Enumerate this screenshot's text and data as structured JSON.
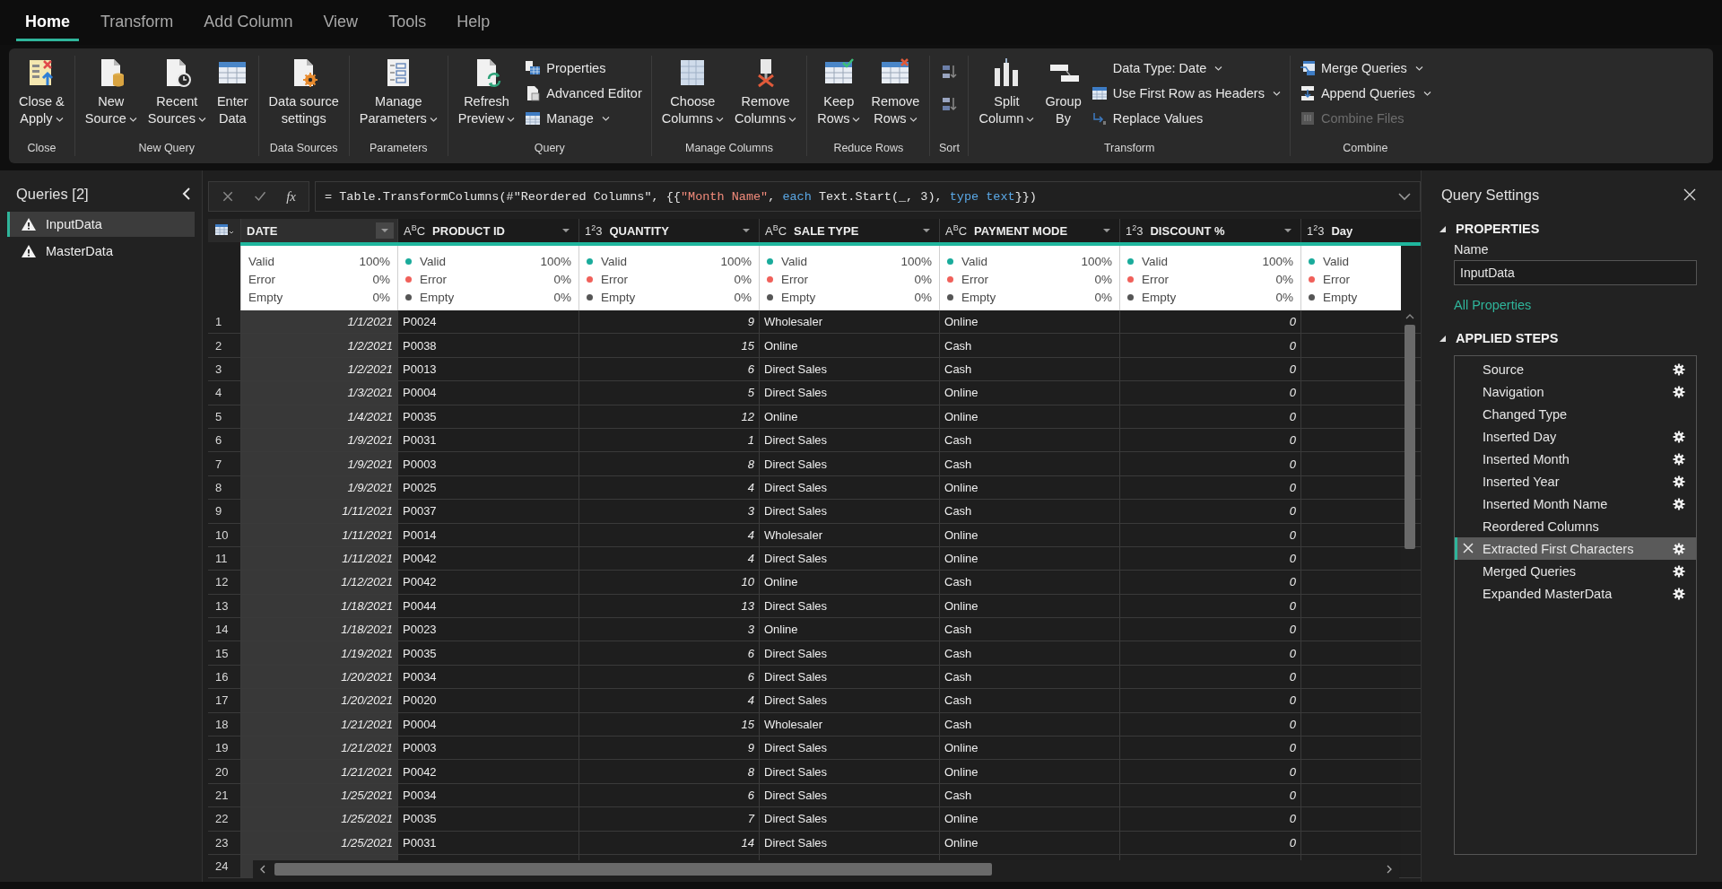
{
  "ribbon_tabs": [
    {
      "label": "Home",
      "selected": true
    },
    {
      "label": "Transform",
      "selected": false
    },
    {
      "label": "Add Column",
      "selected": false
    },
    {
      "label": "View",
      "selected": false
    },
    {
      "label": "Tools",
      "selected": false
    },
    {
      "label": "Help",
      "selected": false
    }
  ],
  "ribbon_groups": [
    {
      "label": "Close",
      "items": [
        {
          "kind": "large",
          "lines": [
            "Close &",
            "Apply"
          ],
          "dropdown": true
        }
      ]
    },
    {
      "label": "New Query",
      "items": [
        {
          "kind": "large",
          "lines": [
            "New",
            "Source"
          ],
          "dropdown": true
        },
        {
          "kind": "large",
          "lines": [
            "Recent",
            "Sources"
          ],
          "dropdown": true
        },
        {
          "kind": "large",
          "lines": [
            "Enter",
            "Data"
          ],
          "dropdown": false
        }
      ]
    },
    {
      "label": "Data Sources",
      "items": [
        {
          "kind": "large",
          "lines": [
            "Data source",
            "settings"
          ],
          "dropdown": false
        }
      ]
    },
    {
      "label": "Parameters",
      "items": [
        {
          "kind": "large",
          "lines": [
            "Manage",
            "Parameters"
          ],
          "dropdown": true
        }
      ]
    },
    {
      "label": "Query",
      "items": [
        {
          "kind": "large",
          "lines": [
            "Refresh",
            "Preview"
          ],
          "dropdown": true
        },
        {
          "kind": "small",
          "label": "Properties",
          "dropdown": false
        },
        {
          "kind": "small",
          "label": "Advanced Editor",
          "dropdown": false
        },
        {
          "kind": "small",
          "label": "Manage",
          "dropdown": true
        }
      ]
    },
    {
      "label": "Manage Columns",
      "items": [
        {
          "kind": "large",
          "lines": [
            "Choose",
            "Columns"
          ],
          "dropdown": true
        },
        {
          "kind": "large",
          "lines": [
            "Remove",
            "Columns"
          ],
          "dropdown": true
        }
      ]
    },
    {
      "label": "Reduce Rows",
      "items": [
        {
          "kind": "large",
          "lines": [
            "Keep",
            "Rows"
          ],
          "dropdown": true
        },
        {
          "kind": "large",
          "lines": [
            "Remove",
            "Rows"
          ],
          "dropdown": true
        }
      ]
    },
    {
      "label": "Sort",
      "items": [
        {
          "kind": "icon"
        },
        {
          "kind": "icon"
        }
      ]
    },
    {
      "label": "Transform",
      "items": [
        {
          "kind": "large",
          "lines": [
            "Split",
            "Column"
          ],
          "dropdown": true
        },
        {
          "kind": "large",
          "lines": [
            "Group",
            "By"
          ],
          "dropdown": false
        },
        {
          "kind": "small",
          "label": "Data Type: Date",
          "dropdown": true
        },
        {
          "kind": "small",
          "label": "Use First Row as Headers",
          "dropdown": true
        },
        {
          "kind": "small",
          "label": "Replace Values",
          "dropdown": false
        }
      ]
    },
    {
      "label": "Combine",
      "items": [
        {
          "kind": "small",
          "label": "Merge Queries",
          "dropdown": true,
          "disabled": false
        },
        {
          "kind": "small",
          "label": "Append Queries",
          "dropdown": true,
          "disabled": false
        },
        {
          "kind": "small",
          "label": "Combine Files",
          "dropdown": false,
          "disabled": true
        }
      ]
    }
  ],
  "queries": {
    "title": "Queries [2]",
    "items": [
      {
        "name": "InputData",
        "warning": true,
        "selected": true
      },
      {
        "name": "MasterData",
        "warning": true,
        "selected": false
      }
    ]
  },
  "formula_bar": {
    "fx": "fx",
    "segments": [
      {
        "text": "= Table.TransformColumns(#\"Reordered Columns\", {{",
        "kind": "plain"
      },
      {
        "text": "\"Month Name\"",
        "kind": "string"
      },
      {
        "text": ", ",
        "kind": "plain"
      },
      {
        "text": "each",
        "kind": "keyword"
      },
      {
        "text": " Text.Start(_, 3), ",
        "kind": "plain"
      },
      {
        "text": "type text",
        "kind": "keyword"
      },
      {
        "text": "}})",
        "kind": "plain"
      }
    ]
  },
  "table": {
    "columns": [
      {
        "name": "DATE",
        "kind": "date",
        "selected": true,
        "filter": true,
        "profile": [
          {
            "label": "Valid",
            "value": "100%"
          },
          {
            "label": "Error",
            "value": "0%"
          },
          {
            "label": "Empty",
            "value": "0%"
          }
        ]
      },
      {
        "name": "PRODUCT ID",
        "type_label": "A$^{B}$C",
        "kind": "text",
        "selected": false,
        "filter": true,
        "profile": [
          {
            "label": "Valid",
            "value": "100%",
            "color": "#1aab9b"
          },
          {
            "label": "Error",
            "value": "0%",
            "color": "#f0605a"
          },
          {
            "label": "Empty",
            "value": "0%",
            "color": "#555555"
          }
        ]
      },
      {
        "name": "QUANTITY",
        "type_label": "1$^{2}$3",
        "kind": "number",
        "selected": false,
        "filter": true,
        "profile": [
          {
            "label": "Valid",
            "value": "100%",
            "color": "#1aab9b"
          },
          {
            "label": "Error",
            "value": "0%",
            "color": "#f0605a"
          },
          {
            "label": "Empty",
            "value": "0%",
            "color": "#555555"
          }
        ]
      },
      {
        "name": "SALE TYPE",
        "type_label": "A$^{B}$C",
        "kind": "text",
        "selected": false,
        "filter": true,
        "profile": [
          {
            "label": "Valid",
            "value": "100%",
            "color": "#1aab9b"
          },
          {
            "label": "Error",
            "value": "0%",
            "color": "#f0605a"
          },
          {
            "label": "Empty",
            "value": "0%",
            "color": "#555555"
          }
        ]
      },
      {
        "name": "PAYMENT MODE",
        "type_label": "A$^{B}$C",
        "kind": "text",
        "selected": false,
        "filter": true,
        "profile": [
          {
            "label": "Valid",
            "value": "100%",
            "color": "#1aab9b"
          },
          {
            "label": "Error",
            "value": "0%",
            "color": "#f0605a"
          },
          {
            "label": "Empty",
            "value": "0%",
            "color": "#555555"
          }
        ]
      },
      {
        "name": "DISCOUNT %",
        "type_label": "1$^{2}$3",
        "kind": "number",
        "selected": false,
        "filter": true,
        "profile": [
          {
            "label": "Valid",
            "value": "100%",
            "color": "#1aab9b"
          },
          {
            "label": "Error",
            "value": "0%",
            "color": "#f0605a"
          },
          {
            "label": "Empty",
            "value": "0%",
            "color": "#555555"
          }
        ]
      },
      {
        "name": "Day",
        "type_label": "1$^{2}$3",
        "kind": "number",
        "selected": false,
        "filter": false,
        "profile": [
          {
            "label": "Valid",
            "color": "#1aab9b"
          },
          {
            "label": "Error",
            "color": "#f0605a"
          },
          {
            "label": "Empty",
            "color": "#555555"
          }
        ]
      }
    ],
    "rows": [
      {
        "number": "1",
        "cells": [
          "1/1/2021",
          "P0024",
          "9",
          "Wholesaler",
          "Online",
          "0"
        ]
      },
      {
        "number": "2",
        "cells": [
          "1/2/2021",
          "P0038",
          "15",
          "Online",
          "Cash",
          "0"
        ]
      },
      {
        "number": "3",
        "cells": [
          "1/2/2021",
          "P0013",
          "6",
          "Direct Sales",
          "Cash",
          "0"
        ]
      },
      {
        "number": "4",
        "cells": [
          "1/3/2021",
          "P0004",
          "5",
          "Direct Sales",
          "Online",
          "0"
        ]
      },
      {
        "number": "5",
        "cells": [
          "1/4/2021",
          "P0035",
          "12",
          "Online",
          "Online",
          "0"
        ]
      },
      {
        "number": "6",
        "cells": [
          "1/9/2021",
          "P0031",
          "1",
          "Direct Sales",
          "Cash",
          "0"
        ]
      },
      {
        "number": "7",
        "cells": [
          "1/9/2021",
          "P0003",
          "8",
          "Direct Sales",
          "Cash",
          "0"
        ]
      },
      {
        "number": "8",
        "cells": [
          "1/9/2021",
          "P0025",
          "4",
          "Direct Sales",
          "Online",
          "0"
        ]
      },
      {
        "number": "9",
        "cells": [
          "1/11/2021",
          "P0037",
          "3",
          "Direct Sales",
          "Cash",
          "0"
        ]
      },
      {
        "number": "10",
        "cells": [
          "1/11/2021",
          "P0014",
          "4",
          "Wholesaler",
          "Online",
          "0"
        ]
      },
      {
        "number": "11",
        "cells": [
          "1/11/2021",
          "P0042",
          "4",
          "Direct Sales",
          "Online",
          "0"
        ]
      },
      {
        "number": "12",
        "cells": [
          "1/12/2021",
          "P0042",
          "10",
          "Online",
          "Cash",
          "0"
        ]
      },
      {
        "number": "13",
        "cells": [
          "1/18/2021",
          "P0044",
          "13",
          "Direct Sales",
          "Online",
          "0"
        ]
      },
      {
        "number": "14",
        "cells": [
          "1/18/2021",
          "P0023",
          "3",
          "Online",
          "Cash",
          "0"
        ]
      },
      {
        "number": "15",
        "cells": [
          "1/19/2021",
          "P0035",
          "6",
          "Direct Sales",
          "Cash",
          "0"
        ]
      },
      {
        "number": "16",
        "cells": [
          "1/20/2021",
          "P0034",
          "6",
          "Direct Sales",
          "Cash",
          "0"
        ]
      },
      {
        "number": "17",
        "cells": [
          "1/20/2021",
          "P0020",
          "4",
          "Direct Sales",
          "Cash",
          "0"
        ]
      },
      {
        "number": "18",
        "cells": [
          "1/21/2021",
          "P0004",
          "15",
          "Wholesaler",
          "Cash",
          "0"
        ]
      },
      {
        "number": "19",
        "cells": [
          "1/21/2021",
          "P0003",
          "9",
          "Direct Sales",
          "Online",
          "0"
        ]
      },
      {
        "number": "20",
        "cells": [
          "1/21/2021",
          "P0042",
          "8",
          "Direct Sales",
          "Online",
          "0"
        ]
      },
      {
        "number": "21",
        "cells": [
          "1/25/2021",
          "P0034",
          "6",
          "Direct Sales",
          "Cash",
          "0"
        ]
      },
      {
        "number": "22",
        "cells": [
          "1/25/2021",
          "P0035",
          "7",
          "Direct Sales",
          "Online",
          "0"
        ]
      },
      {
        "number": "23",
        "cells": [
          "1/25/2021",
          "P0031",
          "14",
          "Direct Sales",
          "Online",
          "0"
        ]
      },
      {
        "number": "24"
      }
    ]
  },
  "query_settings": {
    "title": "Query Settings",
    "properties": {
      "heading": "PROPERTIES",
      "expanded": true,
      "name_label": "Name",
      "name_value": "InputData",
      "link": "All Properties"
    },
    "applied_steps": {
      "heading": "APPLIED STEPS",
      "expanded": true,
      "steps": [
        {
          "label": "Source",
          "gear": true,
          "selected": false
        },
        {
          "label": "Navigation",
          "gear": true,
          "selected": false
        },
        {
          "label": "Changed Type",
          "gear": false,
          "selected": false
        },
        {
          "label": "Inserted Day",
          "gear": true,
          "selected": false
        },
        {
          "label": "Inserted Month",
          "gear": true,
          "selected": false
        },
        {
          "label": "Inserted Year",
          "gear": true,
          "selected": false
        },
        {
          "label": "Inserted Month Name",
          "gear": true,
          "selected": false
        },
        {
          "label": "Reordered Columns",
          "gear": false,
          "selected": false
        },
        {
          "label": "Extracted First Characters",
          "gear": true,
          "selected": true
        },
        {
          "label": "Merged Queries",
          "gear": true,
          "selected": false
        },
        {
          "label": "Expanded MasterData",
          "gear": true,
          "selected": false
        }
      ]
    }
  }
}
